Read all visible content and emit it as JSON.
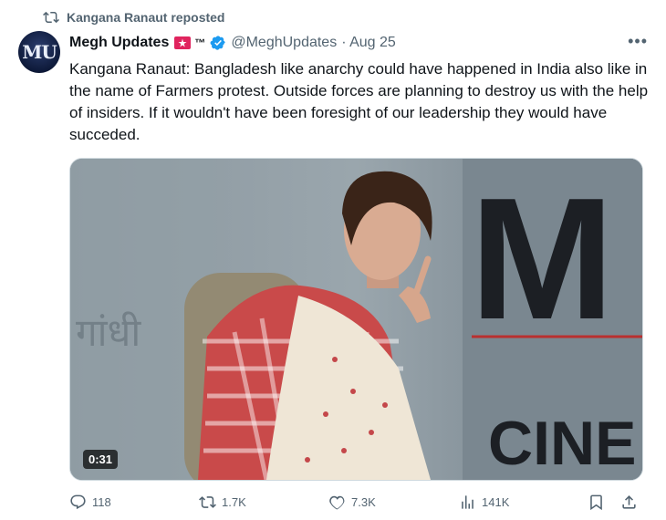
{
  "repost": {
    "label": "Kangana Ranaut reposted"
  },
  "author": {
    "name": "Megh Updates",
    "tm": "™",
    "avatar_text": "MU",
    "handle": "@MeghUpdates",
    "date": "· Aug 25"
  },
  "tweet": {
    "text": "Kangana Ranaut: Bangladesh like anarchy could have happened in India also like in the name of Farmers protest. Outside forces are planning to destroy us with the help of insiders. If it wouldn't have been foresight of our leadership they would have succeded."
  },
  "media": {
    "duration": "0:31",
    "backdrop_text_1": "M",
    "backdrop_text_2": "CINE",
    "backdrop_hindi": "गांधी"
  },
  "actions": {
    "replies": "118",
    "reposts": "1.7K",
    "likes": "7.3K",
    "views": "141K"
  },
  "colors": {
    "accent": "#1d9bf0",
    "muted": "#536471",
    "flag_red": "#e0245e"
  }
}
